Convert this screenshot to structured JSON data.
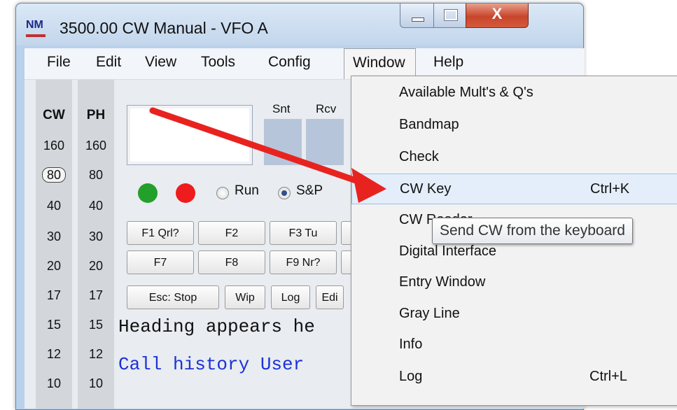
{
  "window": {
    "app_icon": "NM",
    "title": "3500.00 CW Manual - VFO A",
    "close_glyph": "X"
  },
  "menubar": {
    "items": [
      "File",
      "Edit",
      "View",
      "Tools",
      "Config",
      "Window",
      "Help"
    ],
    "active": "Window"
  },
  "bands": {
    "cw_header": "CW",
    "ph_header": "PH",
    "cw": [
      "160",
      "80",
      "40",
      "30",
      "20",
      "17",
      "15",
      "12",
      "10"
    ],
    "ph": [
      "160",
      "80",
      "40",
      "30",
      "20",
      "17",
      "15",
      "12",
      "10"
    ],
    "selected_cw": "80"
  },
  "entry": {
    "snt_label": "Snt",
    "rcv_label": "Rcv",
    "led_colors": [
      "#22a02a",
      "#ee1c1c"
    ],
    "radios": [
      {
        "label": "Run",
        "checked": false
      },
      {
        "label": "S&P",
        "checked": true
      }
    ]
  },
  "fkeys": {
    "row1": [
      "F1 Qrl?",
      "F2",
      "F3 Tu"
    ],
    "row2": [
      "F7",
      "F8",
      "F9 Nr?"
    ],
    "row3": [
      "Esc: Stop",
      "Wip",
      "Log",
      "Edi"
    ]
  },
  "info_window": {
    "heading": "Heading appears he",
    "call_history": "Call history User"
  },
  "window_menu": {
    "items": [
      {
        "label": "Available Mult's & Q's",
        "shortcut": ""
      },
      {
        "label": "Bandmap",
        "shortcut": ""
      },
      {
        "label": "Check",
        "shortcut": ""
      },
      {
        "label": "CW Key",
        "shortcut": "Ctrl+K"
      },
      {
        "label": "CW Reader",
        "shortcut": ""
      },
      {
        "label": "Digital Interface",
        "shortcut": ""
      },
      {
        "label": "Entry Window",
        "shortcut": ""
      },
      {
        "label": "Gray Line",
        "shortcut": ""
      },
      {
        "label": "Info",
        "shortcut": ""
      },
      {
        "label": "Log",
        "shortcut": "Ctrl+L"
      }
    ],
    "highlighted": "CW Key"
  },
  "tooltip": "Send CW from the keyboard",
  "annotation_arrow_color": "#e8231f"
}
